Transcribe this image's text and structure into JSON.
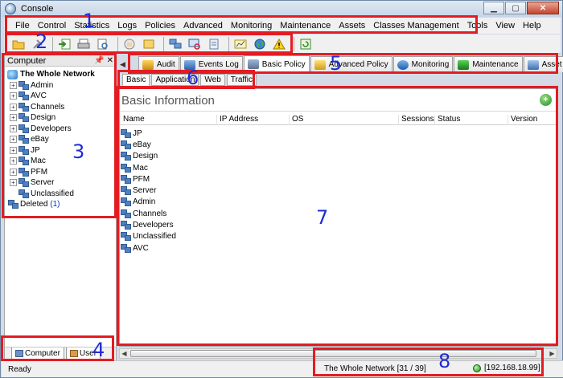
{
  "window": {
    "title": "Console"
  },
  "menu": [
    "File",
    "Control",
    "Statistics",
    "Logs",
    "Policies",
    "Advanced",
    "Monitoring",
    "Maintenance",
    "Assets",
    "Classes Management",
    "Tools",
    "View",
    "Help"
  ],
  "toolbar_icons": [
    "open-folder-icon",
    "pin-icon",
    "import-icon",
    "print-icon",
    "print-preview-icon",
    "globe-hand-icon",
    "notes-icon",
    "computers-icon",
    "monitor-search-icon",
    "report-icon",
    "chart-icon",
    "network-globe-icon",
    "warning-icon",
    "refresh-icon"
  ],
  "left_panel": {
    "title": "Computer",
    "root_label": "The Whole Network",
    "groups": [
      "Admin",
      "AVC",
      "Channels",
      "Design",
      "Developers",
      "eBay",
      "JP",
      "Mac",
      "PFM",
      "Server",
      "Unclassified"
    ],
    "deleted_label": "Deleted",
    "deleted_count": "(1)",
    "tabs": [
      "Computer",
      "User"
    ]
  },
  "main_tabs": [
    "Audit",
    "Events Log",
    "Basic Policy",
    "Advanced Policy",
    "Monitoring",
    "Maintenance",
    "Asset"
  ],
  "sub_tabs": [
    "Basic",
    "Application",
    "Web",
    "Traffic"
  ],
  "content": {
    "title": "Basic Information",
    "columns": [
      "Name",
      "IP Address",
      "OS",
      "Sessions",
      "Status",
      "Version"
    ],
    "rows": [
      "JP",
      "eBay",
      "Design",
      "Mac",
      "PFM",
      "Server",
      "Admin",
      "Channels",
      "Developers",
      "Unclassified",
      "AVC"
    ]
  },
  "status": {
    "ready": "Ready",
    "network": "The Whole Network [31 / 39]",
    "ip": "[192.168.18.99]"
  },
  "annotations": [
    "1",
    "2",
    "3",
    "4",
    "5",
    "6",
    "7",
    "8"
  ],
  "colors": {
    "annotation_box": "#e31c23",
    "annotation_number": "#1e2cd6"
  }
}
